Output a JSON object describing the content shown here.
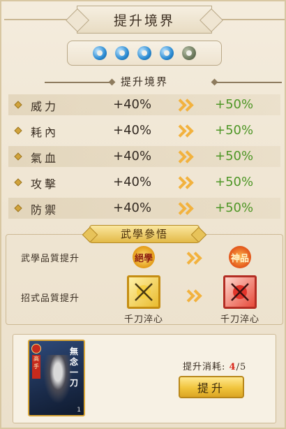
{
  "header": {
    "title": "提升境界"
  },
  "orbs": {
    "filled": 4,
    "total": 5,
    "colors": {
      "filled": "#2a8ad2",
      "empty": "#6d7a5d"
    }
  },
  "stats": {
    "section_title": "提升境界",
    "rows": [
      {
        "name": "威力",
        "current": "+40%",
        "next": "+50%"
      },
      {
        "name": "耗內",
        "current": "+40%",
        "next": "+50%"
      },
      {
        "name": "氣血",
        "current": "+40%",
        "next": "+50%"
      },
      {
        "name": "攻擊",
        "current": "+40%",
        "next": "+50%"
      },
      {
        "name": "防禦",
        "current": "+40%",
        "next": "+50%"
      }
    ]
  },
  "martial": {
    "section_title": "武學參悟",
    "quality_label": "武學品質提升",
    "quality_from": "絕學",
    "quality_to": "神品",
    "move_label": "招式品質提升",
    "move_from": "千刀淬心",
    "move_to": "千刀淬心"
  },
  "card": {
    "title": "無念一刀",
    "tag": "高手",
    "number": "1"
  },
  "cost": {
    "label": "提升消耗:",
    "current": "4",
    "separator": "/",
    "max": "5"
  },
  "button": {
    "label": "提升"
  },
  "colors": {
    "accent_gold": "#f0c43c",
    "bonus_green": "#4e9626",
    "cost_red": "#d9281c"
  }
}
